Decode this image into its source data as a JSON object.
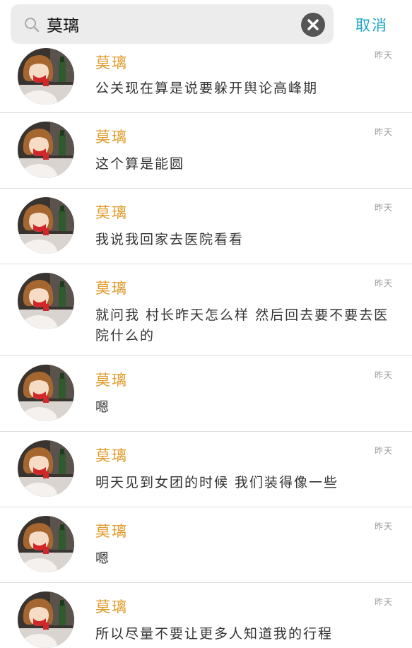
{
  "search": {
    "query": "莫璃",
    "cancel_label": "取消"
  },
  "results": [
    {
      "sender": "莫璃",
      "time": "昨天",
      "message": "公关现在算是说要躲开舆论高峰期"
    },
    {
      "sender": "莫璃",
      "time": "昨天",
      "message": "这个算是能圆"
    },
    {
      "sender": "莫璃",
      "time": "昨天",
      "message": "我说我回家去医院看看"
    },
    {
      "sender": "莫璃",
      "time": "昨天",
      "message": "就问我 村长昨天怎么样 然后回去要不要去医院什么的"
    },
    {
      "sender": "莫璃",
      "time": "昨天",
      "message": "嗯"
    },
    {
      "sender": "莫璃",
      "time": "昨天",
      "message": "明天见到女团的时候 我们装得像一些"
    },
    {
      "sender": "莫璃",
      "time": "昨天",
      "message": "嗯"
    },
    {
      "sender": "莫璃",
      "time": "昨天",
      "message": "所以尽量不要让更多人知道我的行程"
    }
  ],
  "colors": {
    "accent": "#1aa3c9",
    "sender": "#e09a2b"
  }
}
